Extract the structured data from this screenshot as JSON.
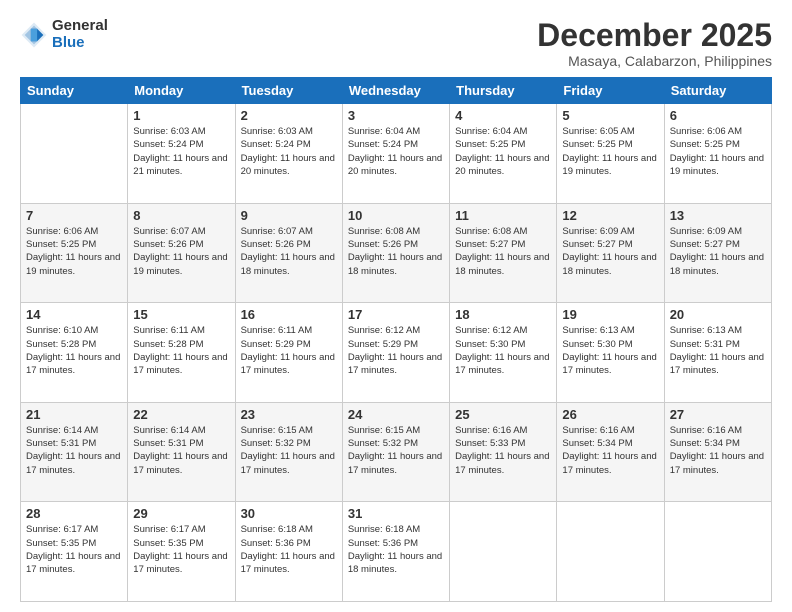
{
  "header": {
    "logo_general": "General",
    "logo_blue": "Blue",
    "main_title": "December 2025",
    "subtitle": "Masaya, Calabarzon, Philippines"
  },
  "calendar": {
    "days_of_week": [
      "Sunday",
      "Monday",
      "Tuesday",
      "Wednesday",
      "Thursday",
      "Friday",
      "Saturday"
    ],
    "weeks": [
      [
        {
          "day": "",
          "info": ""
        },
        {
          "day": "1",
          "info": "Sunrise: 6:03 AM\nSunset: 5:24 PM\nDaylight: 11 hours\nand 21 minutes."
        },
        {
          "day": "2",
          "info": "Sunrise: 6:03 AM\nSunset: 5:24 PM\nDaylight: 11 hours\nand 20 minutes."
        },
        {
          "day": "3",
          "info": "Sunrise: 6:04 AM\nSunset: 5:24 PM\nDaylight: 11 hours\nand 20 minutes."
        },
        {
          "day": "4",
          "info": "Sunrise: 6:04 AM\nSunset: 5:25 PM\nDaylight: 11 hours\nand 20 minutes."
        },
        {
          "day": "5",
          "info": "Sunrise: 6:05 AM\nSunset: 5:25 PM\nDaylight: 11 hours\nand 19 minutes."
        },
        {
          "day": "6",
          "info": "Sunrise: 6:06 AM\nSunset: 5:25 PM\nDaylight: 11 hours\nand 19 minutes."
        }
      ],
      [
        {
          "day": "7",
          "info": "Sunrise: 6:06 AM\nSunset: 5:25 PM\nDaylight: 11 hours\nand 19 minutes."
        },
        {
          "day": "8",
          "info": "Sunrise: 6:07 AM\nSunset: 5:26 PM\nDaylight: 11 hours\nand 19 minutes."
        },
        {
          "day": "9",
          "info": "Sunrise: 6:07 AM\nSunset: 5:26 PM\nDaylight: 11 hours\nand 18 minutes."
        },
        {
          "day": "10",
          "info": "Sunrise: 6:08 AM\nSunset: 5:26 PM\nDaylight: 11 hours\nand 18 minutes."
        },
        {
          "day": "11",
          "info": "Sunrise: 6:08 AM\nSunset: 5:27 PM\nDaylight: 11 hours\nand 18 minutes."
        },
        {
          "day": "12",
          "info": "Sunrise: 6:09 AM\nSunset: 5:27 PM\nDaylight: 11 hours\nand 18 minutes."
        },
        {
          "day": "13",
          "info": "Sunrise: 6:09 AM\nSunset: 5:27 PM\nDaylight: 11 hours\nand 18 minutes."
        }
      ],
      [
        {
          "day": "14",
          "info": "Sunrise: 6:10 AM\nSunset: 5:28 PM\nDaylight: 11 hours\nand 17 minutes."
        },
        {
          "day": "15",
          "info": "Sunrise: 6:11 AM\nSunset: 5:28 PM\nDaylight: 11 hours\nand 17 minutes."
        },
        {
          "day": "16",
          "info": "Sunrise: 6:11 AM\nSunset: 5:29 PM\nDaylight: 11 hours\nand 17 minutes."
        },
        {
          "day": "17",
          "info": "Sunrise: 6:12 AM\nSunset: 5:29 PM\nDaylight: 11 hours\nand 17 minutes."
        },
        {
          "day": "18",
          "info": "Sunrise: 6:12 AM\nSunset: 5:30 PM\nDaylight: 11 hours\nand 17 minutes."
        },
        {
          "day": "19",
          "info": "Sunrise: 6:13 AM\nSunset: 5:30 PM\nDaylight: 11 hours\nand 17 minutes."
        },
        {
          "day": "20",
          "info": "Sunrise: 6:13 AM\nSunset: 5:31 PM\nDaylight: 11 hours\nand 17 minutes."
        }
      ],
      [
        {
          "day": "21",
          "info": "Sunrise: 6:14 AM\nSunset: 5:31 PM\nDaylight: 11 hours\nand 17 minutes."
        },
        {
          "day": "22",
          "info": "Sunrise: 6:14 AM\nSunset: 5:31 PM\nDaylight: 11 hours\nand 17 minutes."
        },
        {
          "day": "23",
          "info": "Sunrise: 6:15 AM\nSunset: 5:32 PM\nDaylight: 11 hours\nand 17 minutes."
        },
        {
          "day": "24",
          "info": "Sunrise: 6:15 AM\nSunset: 5:32 PM\nDaylight: 11 hours\nand 17 minutes."
        },
        {
          "day": "25",
          "info": "Sunrise: 6:16 AM\nSunset: 5:33 PM\nDaylight: 11 hours\nand 17 minutes."
        },
        {
          "day": "26",
          "info": "Sunrise: 6:16 AM\nSunset: 5:34 PM\nDaylight: 11 hours\nand 17 minutes."
        },
        {
          "day": "27",
          "info": "Sunrise: 6:16 AM\nSunset: 5:34 PM\nDaylight: 11 hours\nand 17 minutes."
        }
      ],
      [
        {
          "day": "28",
          "info": "Sunrise: 6:17 AM\nSunset: 5:35 PM\nDaylight: 11 hours\nand 17 minutes."
        },
        {
          "day": "29",
          "info": "Sunrise: 6:17 AM\nSunset: 5:35 PM\nDaylight: 11 hours\nand 17 minutes."
        },
        {
          "day": "30",
          "info": "Sunrise: 6:18 AM\nSunset: 5:36 PM\nDaylight: 11 hours\nand 17 minutes."
        },
        {
          "day": "31",
          "info": "Sunrise: 6:18 AM\nSunset: 5:36 PM\nDaylight: 11 hours\nand 18 minutes."
        },
        {
          "day": "",
          "info": ""
        },
        {
          "day": "",
          "info": ""
        },
        {
          "day": "",
          "info": ""
        }
      ]
    ]
  }
}
